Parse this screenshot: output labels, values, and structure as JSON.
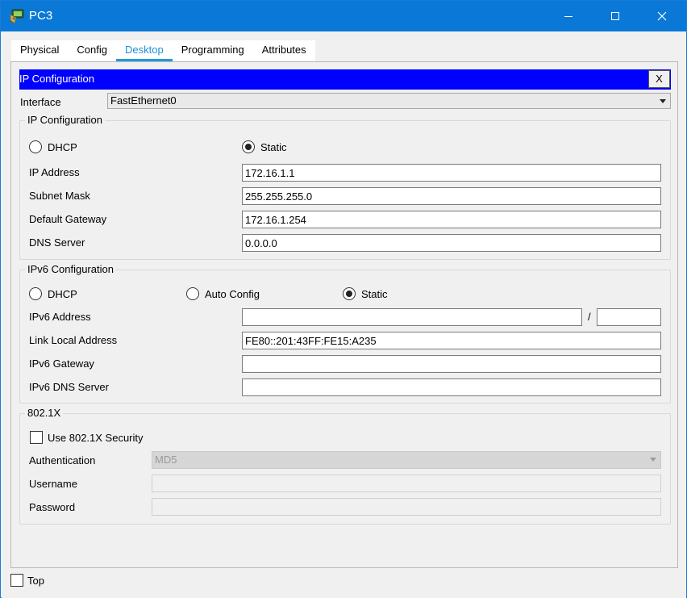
{
  "window": {
    "title": "PC3",
    "app_icon": "packet-tracer-pc-icon",
    "controls": {
      "minimize": "minimize-icon",
      "maximize": "maximize-icon",
      "close": "close-icon"
    }
  },
  "tabs": [
    {
      "label": "Physical",
      "active": false
    },
    {
      "label": "Config",
      "active": false
    },
    {
      "label": "Desktop",
      "active": true
    },
    {
      "label": "Programming",
      "active": false
    },
    {
      "label": "Attributes",
      "active": false
    }
  ],
  "ip_config_bar": {
    "title": "IP Configuration",
    "close_label": "X"
  },
  "interface": {
    "label": "Interface",
    "value": "FastEthernet0"
  },
  "ipv4": {
    "group_title": "IP Configuration",
    "dhcp_label": "DHCP",
    "static_label": "Static",
    "mode": "Static",
    "ip_address": {
      "label": "IP Address",
      "value": "172.16.1.1"
    },
    "subnet_mask": {
      "label": "Subnet Mask",
      "value": "255.255.255.0"
    },
    "default_gateway": {
      "label": "Default Gateway",
      "value": "172.16.1.254"
    },
    "dns_server": {
      "label": "DNS Server",
      "value": "0.0.0.0"
    }
  },
  "ipv6": {
    "group_title": "IPv6 Configuration",
    "dhcp_label": "DHCP",
    "auto_label": "Auto Config",
    "static_label": "Static",
    "mode": "Static",
    "address": {
      "label": "IPv6 Address",
      "value": "",
      "prefix": "",
      "separator": "/"
    },
    "link_local": {
      "label": "Link Local Address",
      "value": "FE80::201:43FF:FE15:A235"
    },
    "gateway": {
      "label": "IPv6 Gateway",
      "value": ""
    },
    "dns_server": {
      "label": "IPv6 DNS Server",
      "value": ""
    }
  },
  "dot1x": {
    "group_title": "802.1X",
    "use_security_label": "Use 802.1X Security",
    "use_security_checked": false,
    "authentication": {
      "label": "Authentication",
      "value": "MD5"
    },
    "username": {
      "label": "Username",
      "value": ""
    },
    "password": {
      "label": "Password",
      "value": ""
    }
  },
  "footer": {
    "top_label": "Top",
    "top_checked": false
  },
  "colors": {
    "titlebar": "#0a78d7",
    "ip_bar": "#0000ff",
    "active_tab": "#1e90d6",
    "background": "#f0f0f0"
  }
}
